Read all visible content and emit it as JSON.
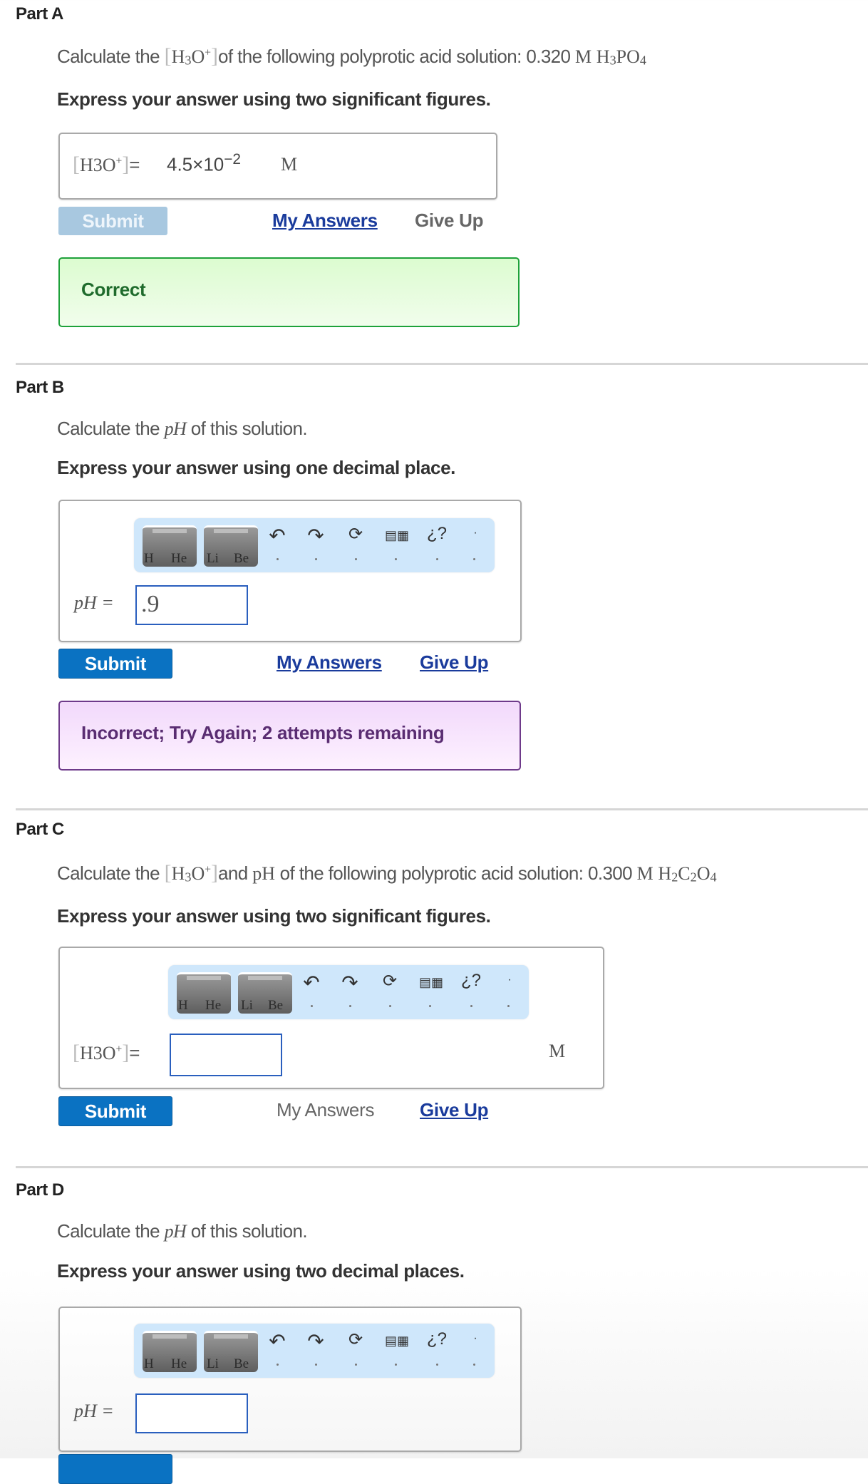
{
  "parts": {
    "a": {
      "title": "Part A",
      "prompt_pre": "Calculate the ",
      "prompt_species": "H3O+",
      "prompt_post": "of the following polyprotic acid solution: 0.320 ",
      "prompt_unit": "M",
      "prompt_formula": "H3PO4",
      "instruction": "Express your answer using two significant figures.",
      "answer_label": "[H3O+]=",
      "answer_value": "4.5×10",
      "answer_exponent": "−2",
      "answer_unit": "M",
      "submit_label": "Submit",
      "submit_state": "disabled",
      "my_answers_label": "My Answers",
      "give_up_label": "Give Up",
      "feedback": "Correct",
      "feedback_color": "#1ea13a"
    },
    "b": {
      "title": "Part B",
      "prompt_pre": "Calculate the ",
      "prompt_var": "pH",
      "prompt_post": " of this solution.",
      "instruction": "Express your answer using one decimal place.",
      "answer_label": "pH =",
      "answer_value": ".9",
      "submit_label": "Submit",
      "my_answers_label": "My Answers",
      "give_up_label": "Give Up",
      "feedback": "Incorrect; Try Again; 2 attempts remaining",
      "feedback_color": "#6e3a8a"
    },
    "c": {
      "title": "Part C",
      "prompt_pre": "Calculate the ",
      "prompt_species": "H3O+",
      "prompt_mid": "and ",
      "prompt_ph": "pH",
      "prompt_post": " of the following polyprotic acid solution: 0.300 ",
      "prompt_unit": "M",
      "prompt_formula": "H2C2O4",
      "instruction": "Express your answer using two significant figures.",
      "answer_label": "[H3O+]=",
      "answer_value": "",
      "answer_unit": "M",
      "submit_label": "Submit",
      "my_answers_label": "My Answers",
      "give_up_label": "Give Up"
    },
    "d": {
      "title": "Part D",
      "prompt_pre": "Calculate the ",
      "prompt_var": "pH",
      "prompt_post": " of this solution.",
      "instruction": "Express your answer using two decimal places.",
      "answer_label": "pH =",
      "answer_value": ""
    }
  },
  "toolbar": {
    "tile1_left": "H",
    "tile1_right": "He",
    "tile2_left": "Li",
    "tile2_right": "Be",
    "icons": [
      "templates-icon",
      "symbols-icon",
      "undo-icon",
      "redo-icon",
      "reset-icon",
      "keyboard-icon",
      "help-icon",
      "more-icon"
    ]
  },
  "colors": {
    "submit_blue": "#0a72c2",
    "link_blue": "#1a3b9c",
    "field_border": "#2a5fbe",
    "toolbar_bg": "#cfe7fb"
  }
}
